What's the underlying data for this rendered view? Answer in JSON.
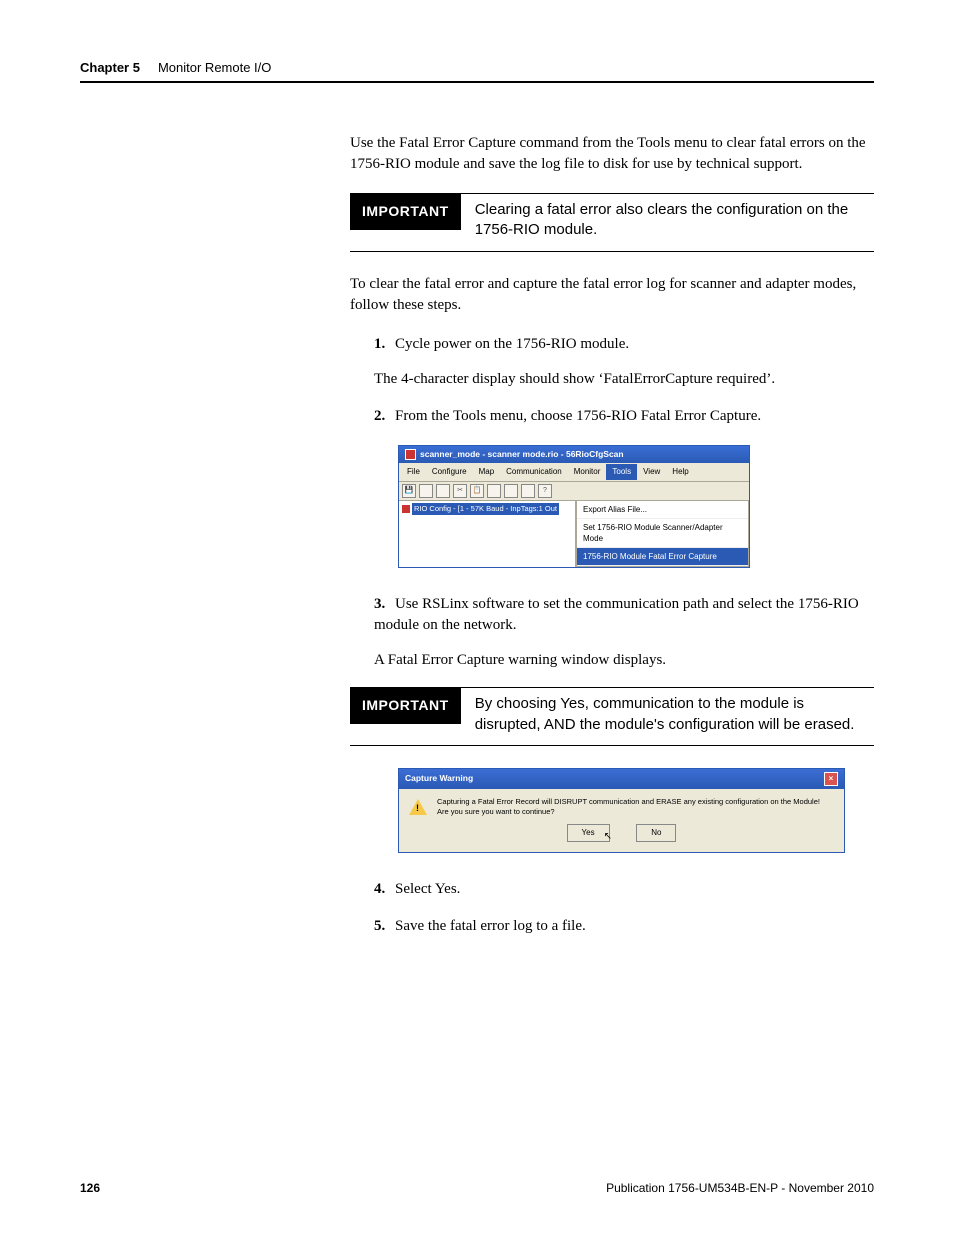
{
  "header": {
    "chapter_label": "Chapter 5",
    "chapter_title": "Monitor Remote I/O"
  },
  "intro_para": "Use the Fatal Error Capture command from the Tools menu to clear fatal errors on the 1756-RIO module and save the log file to disk for use by technical support.",
  "important1": {
    "label": "IMPORTANT",
    "text": "Clearing a fatal error also clears the configuration on the 1756-RIO module."
  },
  "para2": "To clear the fatal error and capture the fatal error log for scanner and adapter modes, follow these steps.",
  "steps": {
    "s1_num": "1.",
    "s1_text": "Cycle power on the 1756-RIO module.",
    "s1_sub": "The 4-character display should show ‘FatalErrorCapture required’.",
    "s2_num": "2.",
    "s2_text": "From the Tools menu, choose 1756-RIO Fatal Error Capture.",
    "s3_num": "3.",
    "s3_text": "Use RSLinx software to set the communication path and select the 1756-RIO module on the network.",
    "s3_sub": "A Fatal Error Capture warning window displays.",
    "s4_num": "4.",
    "s4_text": "Select Yes.",
    "s5_num": "5.",
    "s5_text": "Save the fatal error log to a file."
  },
  "important2": {
    "label": "IMPORTANT",
    "text": "By choosing Yes, communication to the module is disrupted, AND the module's configuration will be erased."
  },
  "fig1": {
    "title": "scanner_mode - scanner mode.rio - 56RioCfgScan",
    "menu": {
      "file": "File",
      "configure": "Configure",
      "map": "Map",
      "communication": "Communication",
      "monitor": "Monitor",
      "tools": "Tools",
      "view": "View",
      "help": "Help"
    },
    "tree_node": "RIO Config - [1 - 57K Baud - InpTags:1 Out",
    "dropdown": {
      "item1": "Export Alias File...",
      "item2": "Set 1756-RIO Module Scanner/Adapter Mode",
      "item3": "1756-RIO Module Fatal Error Capture"
    }
  },
  "fig2": {
    "title": "Capture Warning",
    "msg_line1": "Capturing a Fatal Error Record will DISRUPT communication and ERASE any existing configuration on the Module!",
    "msg_line2": "Are you sure you want to continue?",
    "yes": "Yes",
    "no": "No"
  },
  "footer": {
    "page": "126",
    "pub": "Publication 1756-UM534B-EN-P - November 2010"
  }
}
